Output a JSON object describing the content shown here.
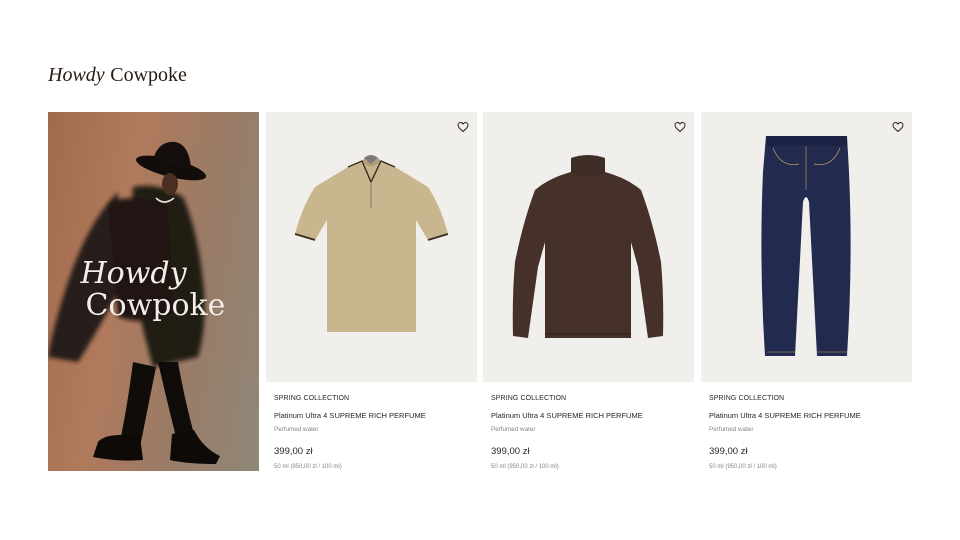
{
  "brand": {
    "part1": "Howdy",
    "part2": "Cowpoke"
  },
  "hero": {
    "line1": "Howdy",
    "line2": "Cowpoke"
  },
  "products": [
    {
      "collection": "SPRING COLLECTION",
      "name": "Platinum Ultra 4 SUPREME RICH PERFUME",
      "type": "Perfumed water",
      "price": "399,00 zł",
      "unit_price": "50 ml (950,00 zł / 100 ml)",
      "image_icon": "polo-shirt-image"
    },
    {
      "collection": "SPRING COLLECTION",
      "name": "Platinum Ultra 4 SUPREME RICH PERFUME",
      "type": "Perfumed water",
      "price": "399,00 zł",
      "unit_price": "50 ml (950,00 zł / 100 ml)",
      "image_icon": "turtleneck-sweater-image"
    },
    {
      "collection": "SPRING COLLECTION",
      "name": "Platinum Ultra 4 SUPREME RICH PERFUME",
      "type": "Perfumed water",
      "price": "399,00 zł",
      "unit_price": "50 ml (950,00 zł / 100 ml)",
      "image_icon": "jeans-image"
    }
  ],
  "icons": {
    "wishlist": "heart-icon"
  },
  "colors": {
    "card_bg": "#f1efeb",
    "brand": "#2b1a14",
    "muted": "#8b8480"
  }
}
